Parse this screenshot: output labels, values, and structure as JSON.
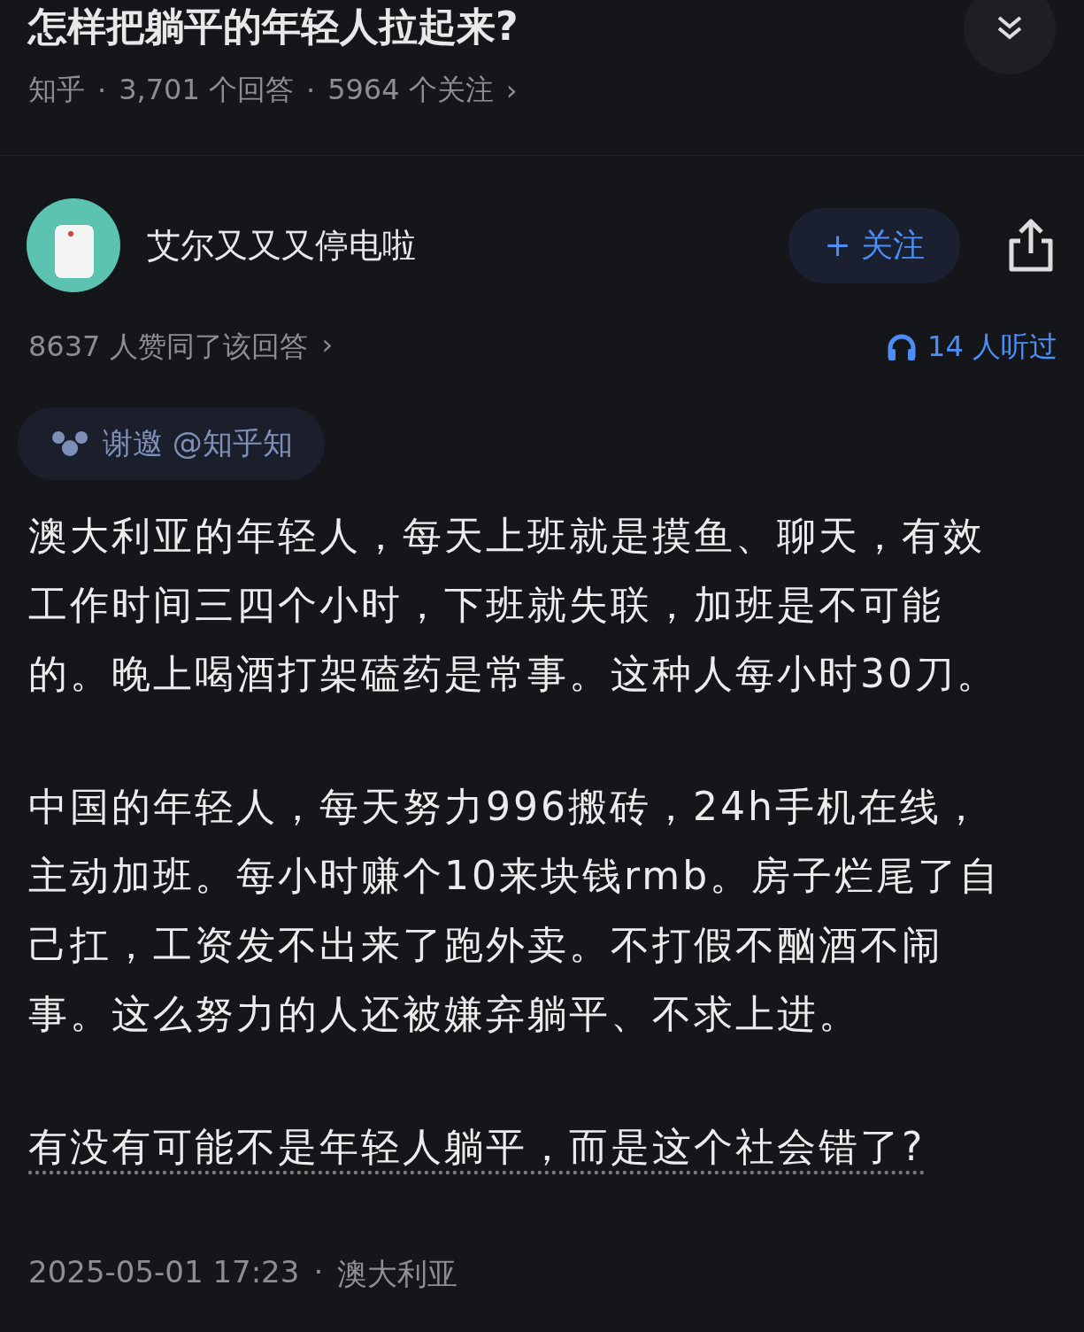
{
  "question": {
    "title": "怎样把躺平的年轻人拉起来?",
    "source": "知乎",
    "answers": "3,701 个回答",
    "followers": "5964 个关注",
    "separators": [
      "·",
      "·"
    ],
    "chevron": "›"
  },
  "author": {
    "name": "艾尔又又又停电啦",
    "follow_button": "+ 关注"
  },
  "stats": {
    "approvals": "8637 人赞同了该回答",
    "chevron": "›",
    "listens": "14 人听过"
  },
  "invite": {
    "label": "谢邀 @知乎知"
  },
  "paragraphs": [
    {
      "kind": "plain",
      "text": "澳大利亚的年轻人，每天上班就是摸鱼、聊天，有效工作时间三四个小时，下班就失联，加班是不可能的。晚上喝酒打架磕药是常事。这种人每小时30刀。"
    },
    {
      "kind": "plain",
      "text": "中国的年轻人，每天努力996搬砖，24h手机在线，主动加班。每小时赚个10来块钱rmb。房子烂尾了自己扛，工资发不出来了跑外卖。不打假不酗酒不闹事。这么努力的人还被嫌弃躺平、不求上进。"
    },
    {
      "kind": "underlined",
      "text": "有没有可能不是年轻人躺平，而是这个社会错了?"
    }
  ],
  "footer": {
    "time": "2025-05-01 17:23",
    "separator": "·",
    "location": "澳大利亚"
  }
}
